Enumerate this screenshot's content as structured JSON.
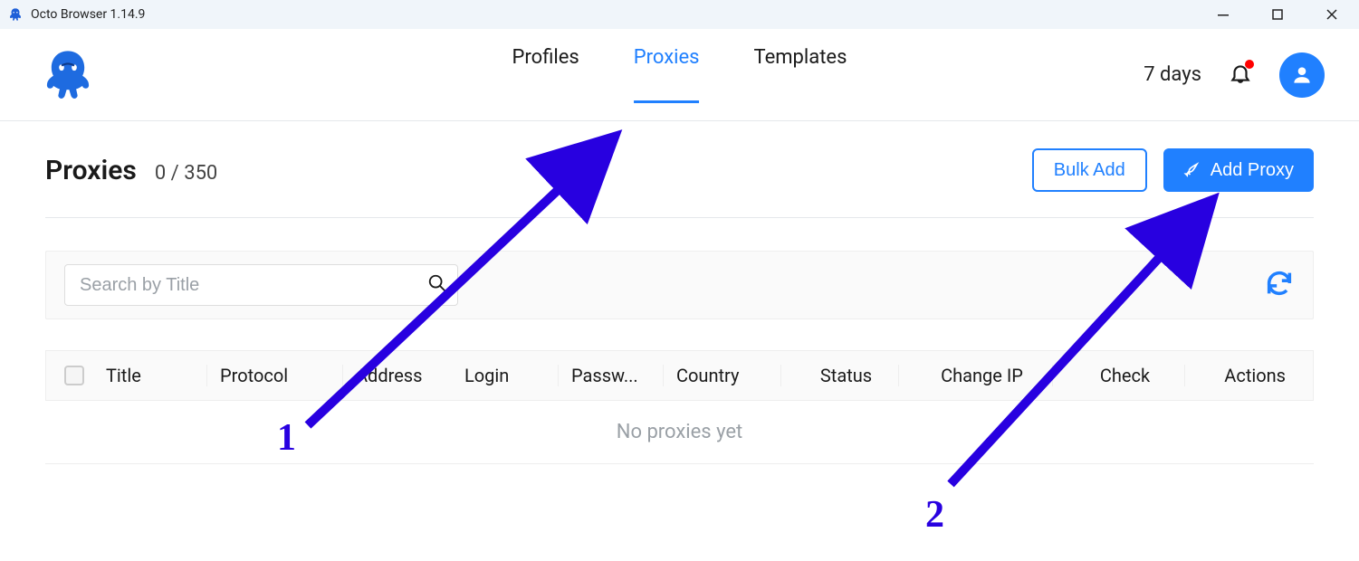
{
  "titlebar": {
    "title": "Octo Browser 1.14.9"
  },
  "nav": {
    "items": [
      {
        "label": "Profiles",
        "active": false
      },
      {
        "label": "Proxies",
        "active": true
      },
      {
        "label": "Templates",
        "active": false
      }
    ]
  },
  "header": {
    "days": "7 days"
  },
  "page": {
    "title": "Proxies",
    "count": "0 / 350",
    "bulk_add": "Bulk Add",
    "add_proxy": "Add Proxy"
  },
  "search": {
    "placeholder": "Search by Title"
  },
  "table": {
    "headers": {
      "title": "Title",
      "protocol": "Protocol",
      "address": "Address",
      "login": "Login",
      "password": "Passw...",
      "country": "Country",
      "status": "Status",
      "changeip": "Change IP",
      "check": "Check",
      "actions": "Actions"
    },
    "empty": "No proxies yet"
  },
  "annotations": {
    "one": "1",
    "two": "2"
  }
}
